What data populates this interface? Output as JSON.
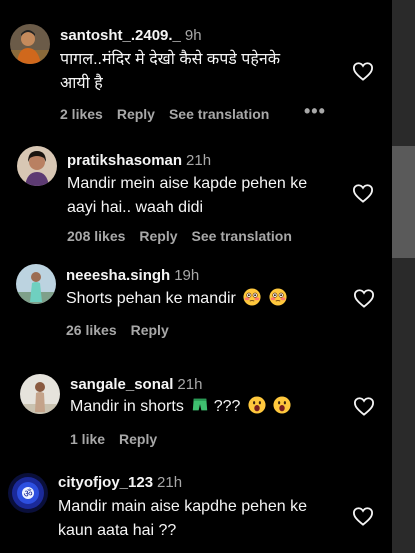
{
  "comments": [
    {
      "username": "santosht_.2409._",
      "time": "9h",
      "lines": [
        "पागल..मंदिर मे देखो कैसे कपडे पहेनके",
        "आयी है"
      ],
      "likes": "2 likes",
      "reply": "Reply",
      "translate": "See translation",
      "more": "•••",
      "emojis": []
    },
    {
      "username": "pratikshasoman",
      "time": "21h",
      "lines": [
        "Mandir mein aise kapde pehen ke",
        "aayi hai.. waah didi"
      ],
      "likes": "208 likes",
      "reply": "Reply",
      "translate": "See translation",
      "emojis": []
    },
    {
      "username": "neeesha.singh",
      "time": "19h",
      "lines": [
        "Shorts pehan ke mandir"
      ],
      "likes": "26 likes",
      "reply": "Reply",
      "emojis": [
        "flushed-face",
        "flushed-face"
      ]
    },
    {
      "username": "sangale_sonal",
      "time": "21h",
      "lines": [
        "Mandir in shorts",
        "???"
      ],
      "likes": "1 like",
      "reply": "Reply",
      "emojis": [
        "shorts",
        "open-mouth-face",
        "open-mouth-face"
      ]
    },
    {
      "username": "cityofjoy_123",
      "time": "21h",
      "lines": [
        "Mandir main aise kapdhe pehen ke",
        "kaun aata hai ??"
      ],
      "emojis": []
    }
  ],
  "colors": {
    "background": "#000000",
    "primary_text": "#f5f5f5",
    "secondary_text": "#a8a8a8",
    "scrollbar_track": "#2a2a2a",
    "scrollbar_thumb": "#5a5a5a"
  }
}
